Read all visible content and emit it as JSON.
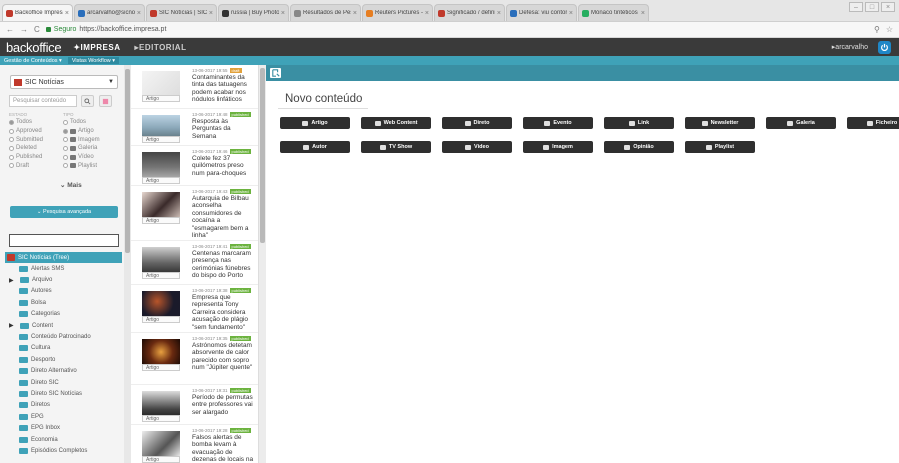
{
  "browser": {
    "tabs": [
      {
        "label": "Backoffice Impresa",
        "color": "#c0392b"
      },
      {
        "label": "arcarvalho@sicnoticias.",
        "color": "#2a6ebb"
      },
      {
        "label": "SIC Notícias | SIC Notíc",
        "color": "#c0392b"
      },
      {
        "label": "russia | Buy Photos | AP",
        "color": "#333333"
      },
      {
        "label": "Resultados de Pesquisa",
        "color": "#888888"
      },
      {
        "label": "Reuters Pictures - GUAT",
        "color": "#e67e22"
      },
      {
        "label": "Significado / definição",
        "color": "#c0392b"
      },
      {
        "label": "Defesa: viu contornar os",
        "color": "#2a6ebb"
      },
      {
        "label": "Mónaco tintéticos incidi",
        "color": "#27ae60"
      }
    ],
    "secure_label": "Seguro",
    "url": "https://backoffice.impresa.pt"
  },
  "header": {
    "logo": "backoffice",
    "menu_impresa": "✦IMPRESA",
    "menu_editorial": "▸EDITORIAL",
    "user": "▸arcarvalho"
  },
  "subbar": {
    "item1": "Gestão de Conteúdos ▾",
    "item2": "Vistas Workflow ▾"
  },
  "left": {
    "site_select": "SIC Notícias",
    "search_placeholder": "Pesquisar conteúdo",
    "estado_header": "ESTADO",
    "tipo_header": "TIPO",
    "estados": [
      "Todos",
      "Approved",
      "Submitted",
      "Deleted",
      "Published",
      "Draft"
    ],
    "tipos": [
      "Todos",
      "Artigo",
      "Imagem",
      "Galeria",
      "Vídeo",
      "Playlist"
    ],
    "mais": "⌄ Mais",
    "pesquisa_avancada": "⌄ Pesquisa avançada",
    "tree_root": "SIC Notícias (Tree)",
    "tree_items": [
      "Alertas SMS",
      "Arquivo",
      "Autores",
      "Bolsa",
      "Categorias",
      "Content",
      "Conteúdo Patrocinado",
      "Cultura",
      "Desporto",
      "Direto Alternativo",
      "Direto SIC",
      "Direto SIC Notícias",
      "Diretos",
      "EPG",
      "EPG Inbox",
      "Economia",
      "Episódios Completos"
    ]
  },
  "items": [
    {
      "date": "13-06-2017 19:55",
      "status": "draft",
      "title": "Contaminantes da tinta das tatuagens podem acabar nos nódulos linfáticos",
      "tag": "Artigo"
    },
    {
      "date": "13-06-2017 19:48",
      "status": "published",
      "title": "Resposta às Perguntas da Semana",
      "tag": "Artigo"
    },
    {
      "date": "13-06-2017 19:46",
      "status": "published",
      "title": "Colete fez 37 quilómetros preso num para-choques",
      "tag": "Artigo"
    },
    {
      "date": "13-06-2017 19:43",
      "status": "published",
      "title": "Autarquia de Bilbau aconselha consumidores de cocaína a \"esmagarem bem a linha\"",
      "tag": "Artigo"
    },
    {
      "date": "13-06-2017 19:41",
      "status": "published",
      "title": "Centenas marcaram presença nas cerimónias fúnebres do bispo do Porto",
      "tag": "Artigo"
    },
    {
      "date": "13-06-2017 19:38",
      "status": "published",
      "title": "Empresa que representa Tony Carreira considera acusação de plágio \"sem fundamento\"",
      "tag": "Artigo"
    },
    {
      "date": "13-06-2017 19:35",
      "status": "published",
      "title": "Astrónomos detetam absorvente de calor parecido com sopro num \"Júpiter quente\"",
      "tag": "Artigo"
    },
    {
      "date": "13-06-2017 19:31",
      "status": "published",
      "title": "Período de permutas entre professores vai ser alargado",
      "tag": "Artigo"
    },
    {
      "date": "13-06-2017 19:28",
      "status": "published",
      "title": "Falsos alertas de bomba levam à evacuação de dezenas de locais na Rússia",
      "tag": "Artigo"
    }
  ],
  "main": {
    "title": "Novo conteúdo",
    "row1": [
      "Artigo",
      "Web Content",
      "Direto",
      "Evento",
      "Link",
      "Newsletter",
      "Galeria",
      "Ficheiro"
    ],
    "row2": [
      "Autor",
      "TV Show",
      "Video",
      "Imagem",
      "Opinião",
      "Playlist"
    ]
  }
}
